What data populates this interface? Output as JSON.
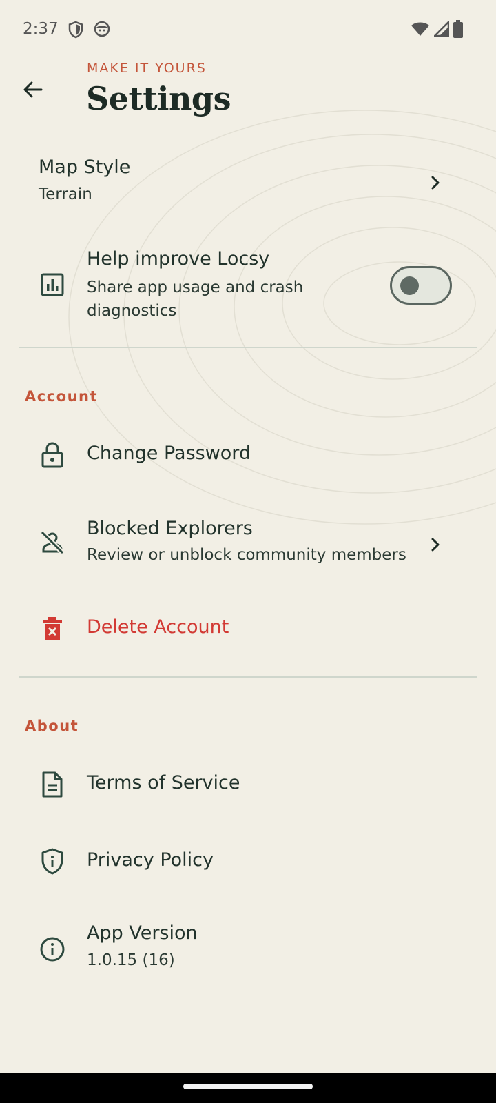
{
  "status_bar": {
    "time": "2:37",
    "icons": [
      "shield-icon",
      "face-icon",
      "wifi-icon",
      "signal-icon",
      "battery-icon"
    ]
  },
  "header": {
    "eyebrow": "MAKE IT YOURS",
    "title": "Settings",
    "back_icon": "arrow-back-icon"
  },
  "general": {
    "map_style": {
      "title": "Map Style",
      "value": "Terrain"
    },
    "help_improve": {
      "title": "Help improve Locsy",
      "subtitle_line1": "Share app usage and crash",
      "subtitle_line2": "diagnostics",
      "toggle_on": false
    }
  },
  "account": {
    "label": "Account",
    "change_password": "Change Password",
    "blocked_explorers": {
      "title": "Blocked Explorers",
      "subtitle": "Review or unblock community members"
    },
    "delete_account": "Delete Account"
  },
  "about": {
    "label": "About",
    "terms": "Terms of Service",
    "privacy": "Privacy Policy",
    "app_version": {
      "title": "App Version",
      "value": "1.0.15 (16)"
    }
  },
  "colors": {
    "background": "#f2efe5",
    "accent": "#c4553a",
    "danger": "#d23a34",
    "icon": "#2e4a3f"
  }
}
